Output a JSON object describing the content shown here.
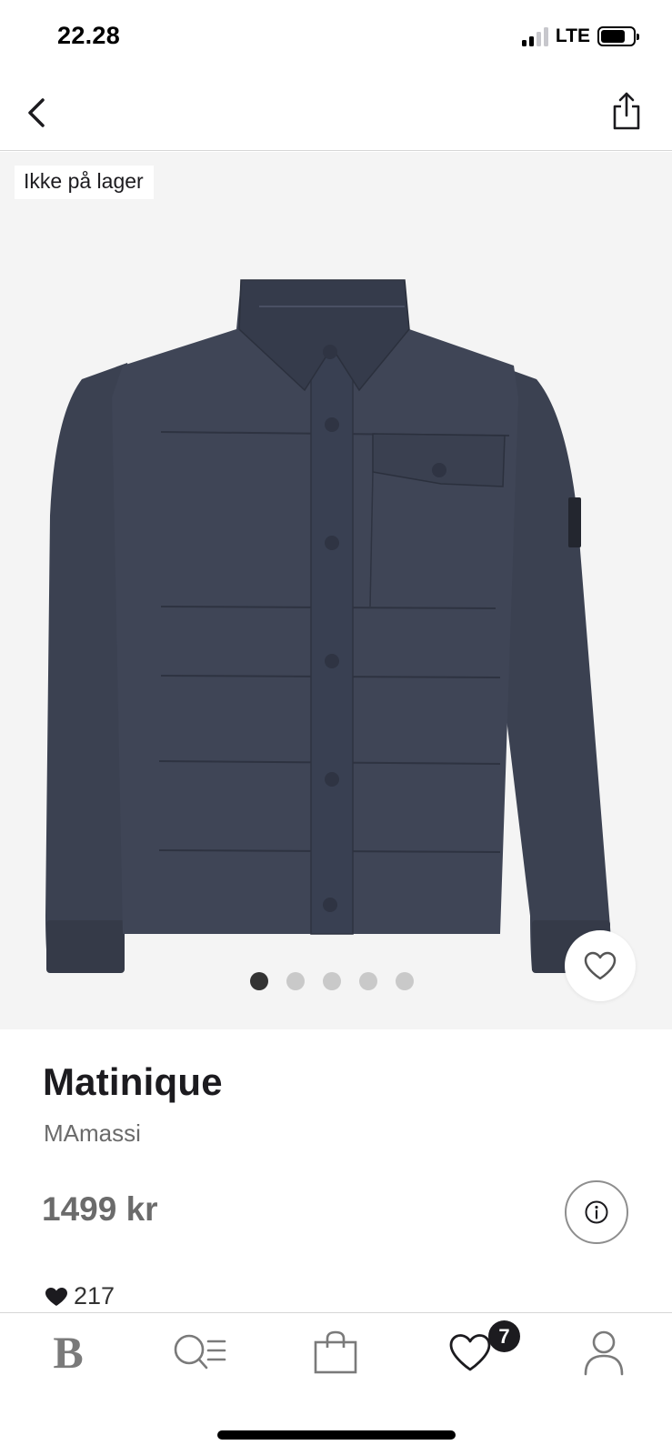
{
  "status_bar": {
    "time": "22.28",
    "network": "LTE",
    "signal_bars_active": 2,
    "signal_bars_total": 4,
    "battery_level": 0.75
  },
  "nav": {
    "back_icon": "chevron-left-icon",
    "share_icon": "share-icon"
  },
  "gallery": {
    "stock_label": "Ikke på lager",
    "image_count": 5,
    "active_index": 0,
    "favorite_icon": "heart-outline-icon"
  },
  "product": {
    "brand": "Matinique",
    "name": "MAmassi",
    "price": "1499 kr",
    "likes": "217",
    "info_icon": "info-icon"
  },
  "tab_bar": {
    "home_logo": "B",
    "search_icon": "search-list-icon",
    "bag_icon": "shopping-bag-icon",
    "favorites_icon": "heart-icon",
    "favorites_badge": "7",
    "profile_icon": "user-icon"
  },
  "colors": {
    "jacket": "#3b4151",
    "gallery_bg": "#f4f4f4",
    "muted_text": "#6b6b6b",
    "primary_text": "#1c1b1f"
  }
}
